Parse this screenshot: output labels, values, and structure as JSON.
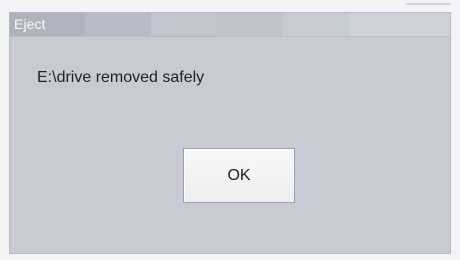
{
  "dialog": {
    "title": "Eject",
    "message": "E:\\drive removed safely",
    "ok_label": "OK"
  },
  "colors": {
    "dialog_background": "#c8cbd3",
    "title_text": "#f8f8fa",
    "button_background": "#f4f4f5"
  }
}
